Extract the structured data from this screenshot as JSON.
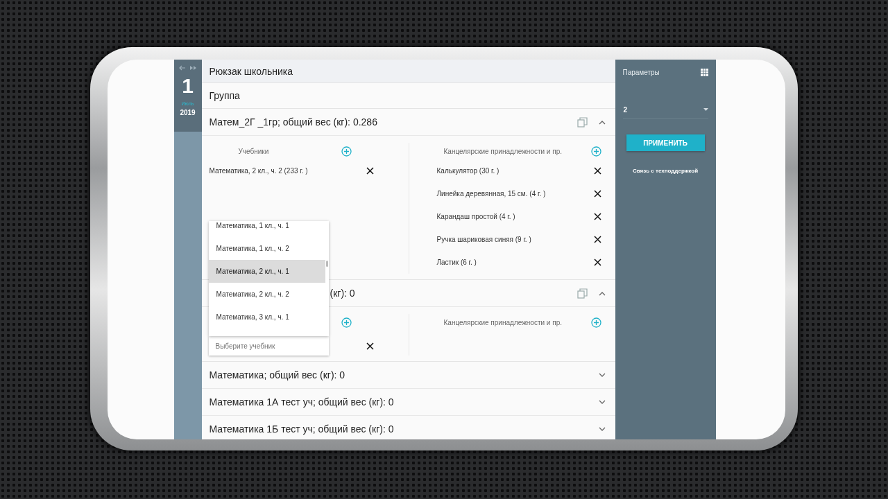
{
  "date": {
    "day": "1",
    "month": "Июль",
    "year": "2019"
  },
  "title": "Рюкзак школьника",
  "group_label": "Группа",
  "groups": [
    {
      "title": "Матем_2Г _1гр; общий вес (кг): 0.286",
      "expanded": true,
      "textbooks": {
        "header": "Учебники",
        "items": [
          "Математика, 2 кл., ч. 2 (233 г. )"
        ]
      },
      "supplies": {
        "header": "Канцелярские принадлежности и пр.",
        "items": [
          "Калькулятор (30 г. )",
          "Линейка деревянная, 15 см. (4 г. )",
          "Карандаш простой (4 г. )",
          "Ручка шариковая синяя (9 г. )",
          "Ластик (6 г. )"
        ]
      }
    },
    {
      "title": "(кг): 0",
      "expanded": true,
      "textbooks": {
        "input": {
          "placeholder": "Выберите учебник"
        },
        "dropdown": [
          {
            "label": "Математика, 1 кл., ч. 1",
            "selected": false
          },
          {
            "label": "Математика, 1 кл., ч. 2",
            "selected": false
          },
          {
            "label": "Математика, 2 кл., ч. 1",
            "selected": true
          },
          {
            "label": "Математика, 2 кл., ч. 2",
            "selected": false
          },
          {
            "label": "Математика, 3 кл., ч. 1",
            "selected": false
          }
        ]
      },
      "supplies": {
        "header": "Канцелярские принадлежности и пр."
      }
    },
    {
      "title": "Математика; общий вес (кг): 0",
      "expanded": false
    },
    {
      "title": "Математика 1А тест уч; общий вес (кг): 0",
      "expanded": false
    },
    {
      "title": "Математика 1Б тест уч; общий вес (кг): 0",
      "expanded": false
    }
  ],
  "panel": {
    "title": "Параметры",
    "select_value": "2",
    "apply_button": "ПРИМЕНИТЬ",
    "support_link": "Связь с техподдержкой"
  }
}
